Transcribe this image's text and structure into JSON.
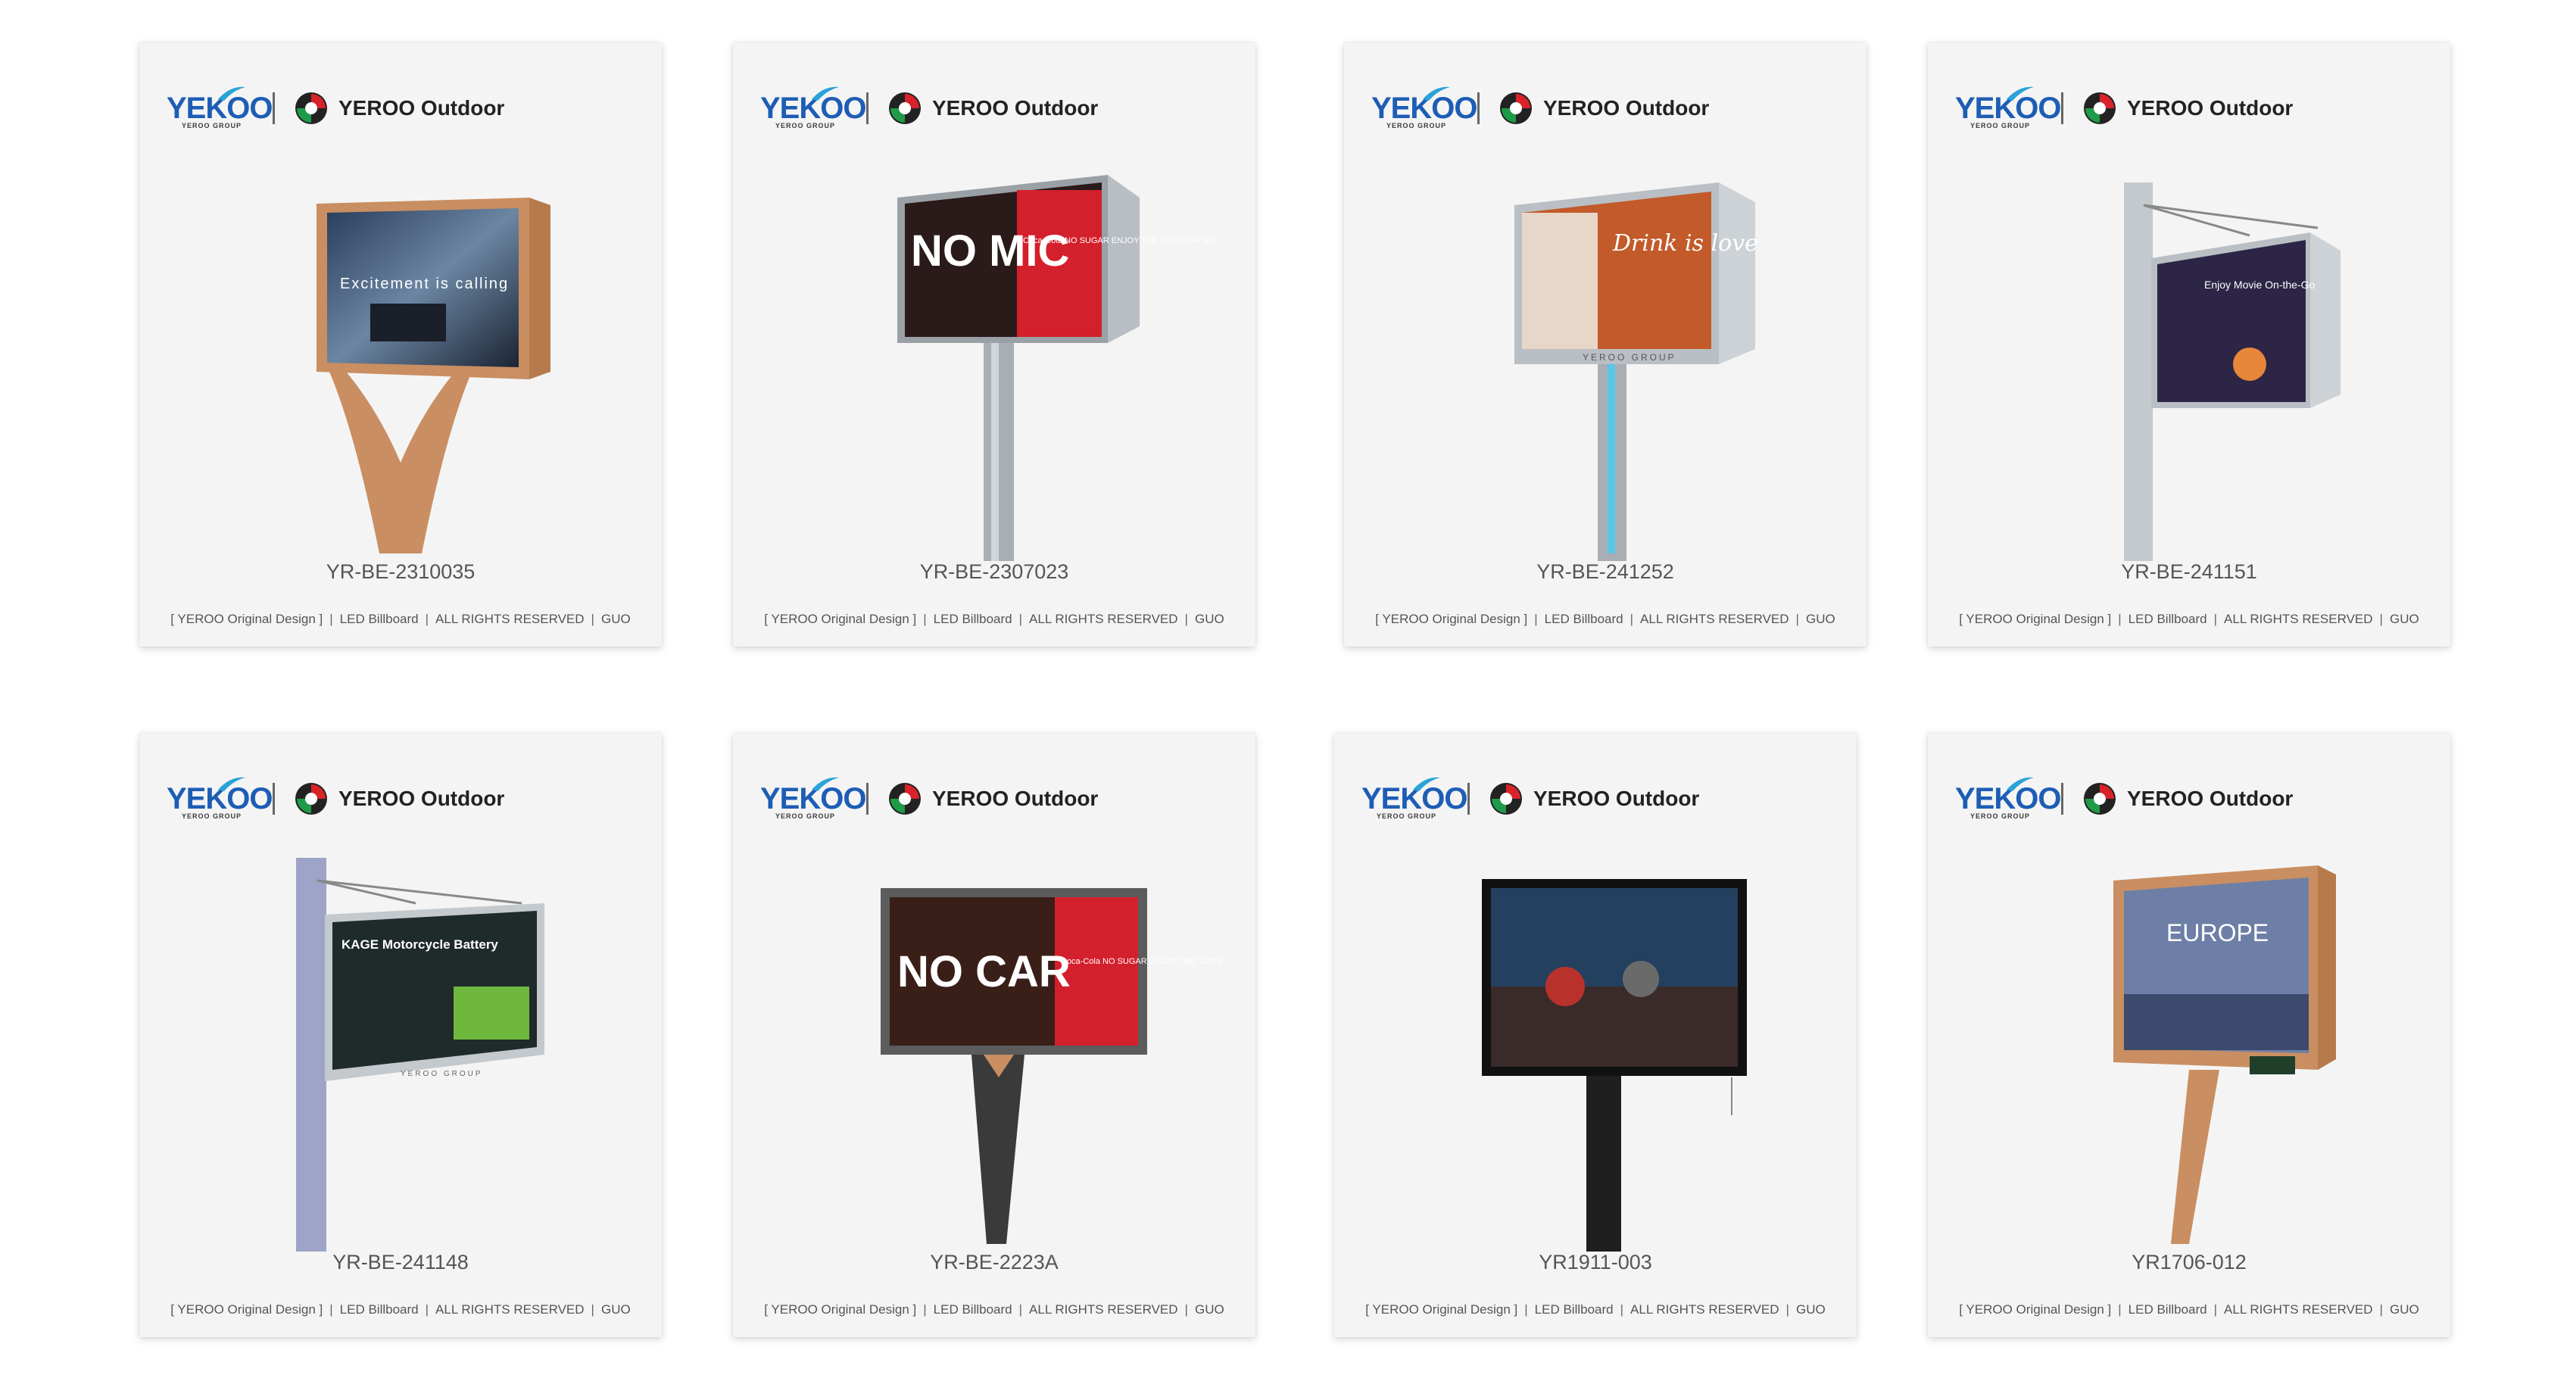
{
  "brand": {
    "left_logo_text": "YEKOO",
    "left_logo_subtext": "YEROO GROUP",
    "right_logo_text": "YEROO Outdoor"
  },
  "footer": {
    "original_design": "[ YEROO Original Design ]",
    "category": "LED Billboard",
    "rights": "ALL RIGHTS RESERVED",
    "author": "GUO"
  },
  "colors": {
    "card_bg": "#f4f4f4",
    "brand_blue": "#1d5db5",
    "brand_cyan": "#2aa3d8",
    "text_gray": "#555555"
  },
  "products": [
    {
      "model": "YR-BE-2310035",
      "screen_text": "Excitement is calling",
      "style": "wood-frame-arch-leg"
    },
    {
      "model": "YR-BE-2307023",
      "screen_text_left": "NO MIC",
      "screen_text_right": "Coca-Cola NO SUGAR ENJOY THE TASTE OF NO",
      "style": "silver-frame-pole"
    },
    {
      "model": "YR-BE-241252",
      "screen_text": "Drink is love",
      "screen_subtext": "YEROO GROUP",
      "style": "silver-frame-blue-pole"
    },
    {
      "model": "YR-BE-241151",
      "screen_text": "Enjoy Movie On-the-Go",
      "style": "side-pole-cable"
    },
    {
      "model": "YR-BE-241148",
      "screen_title": "KAGE Motorcycle Battery",
      "screen_subtext": "YEROO GROUP",
      "style": "side-pole-cable-silver"
    },
    {
      "model": "YR-BE-2223A",
      "screen_text_left": "NO CAR",
      "screen_text_right": "Coca-Cola NO SUGAR ENJOY THE TASTE OF NO",
      "style": "dark-frame-tapered-leg"
    },
    {
      "model": "YR1911-003",
      "screen_text": "",
      "style": "black-frame-black-pole"
    },
    {
      "model": "YR1706-012",
      "screen_text": "EUROPE",
      "style": "wood-frame-angled-leg"
    }
  ]
}
